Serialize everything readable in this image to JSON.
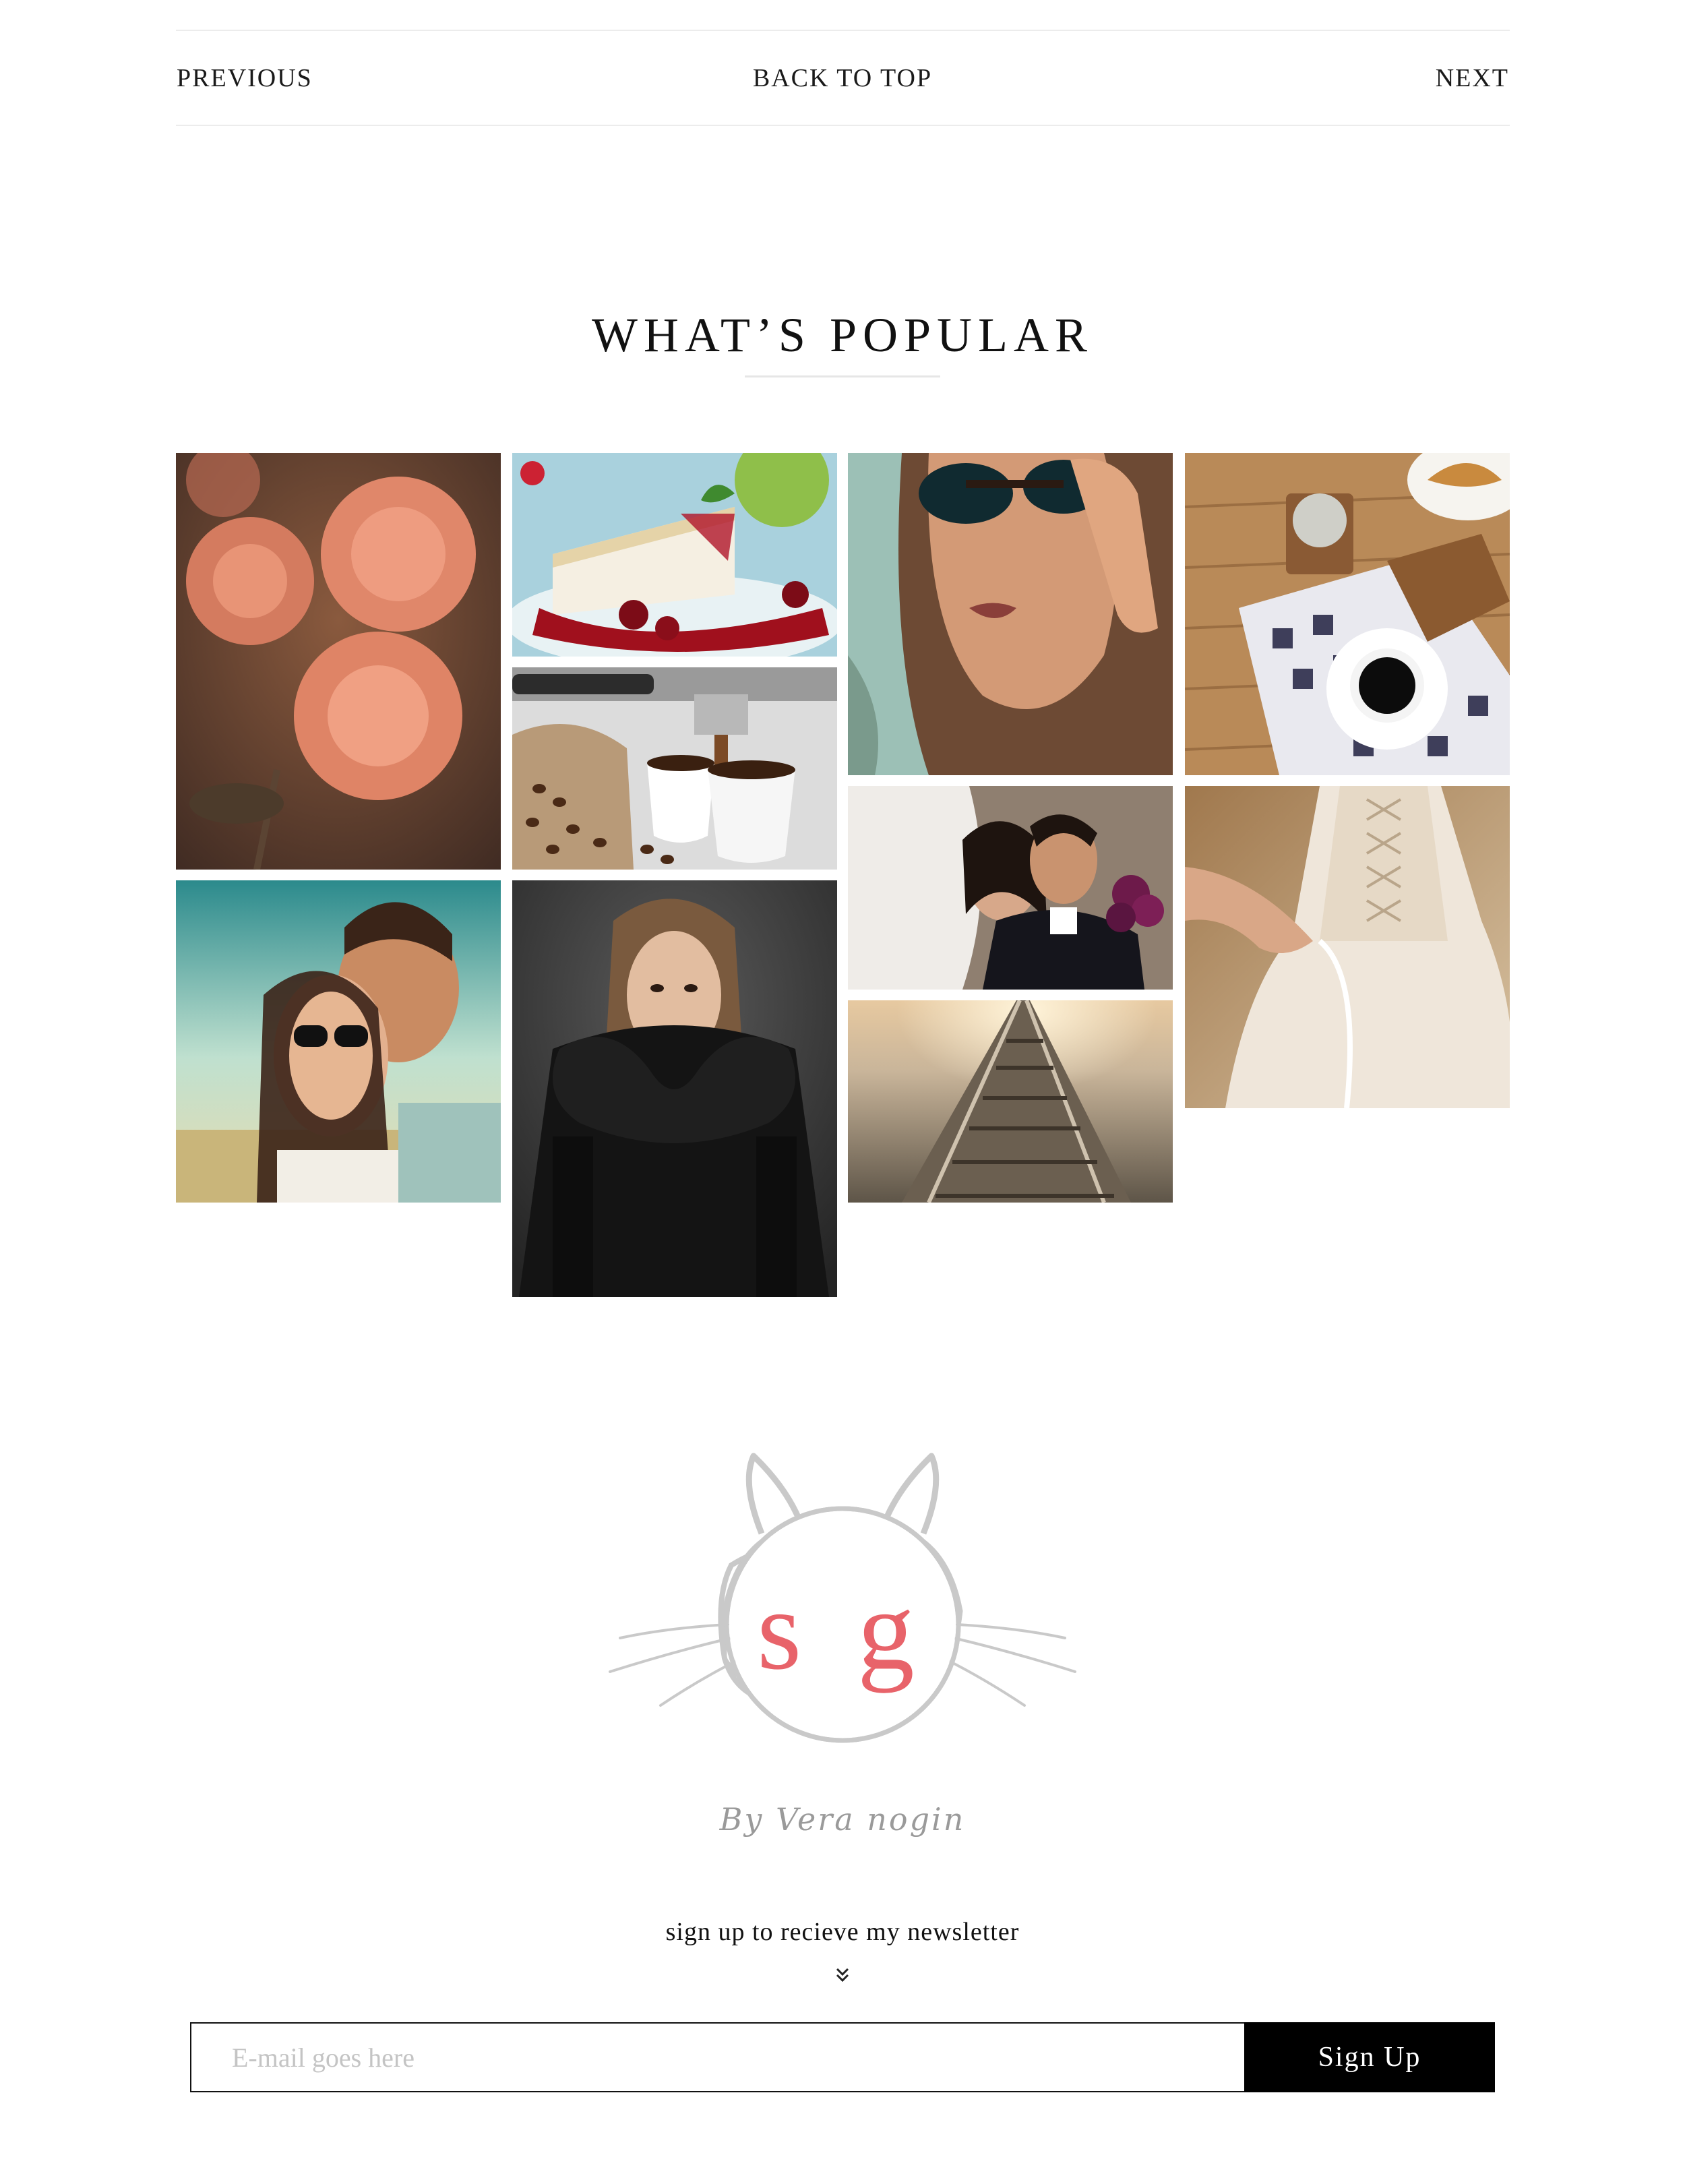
{
  "post_nav": {
    "previous_label": "PREVIOUS",
    "back_to_top_label": "BACK TO TOP",
    "next_label": "NEXT"
  },
  "popular": {
    "title": "WHAT’S POPULAR",
    "tiles": [
      {
        "name": "popular-roses"
      },
      {
        "name": "popular-cheesecake"
      },
      {
        "name": "popular-espresso"
      },
      {
        "name": "popular-sunglasses-woman"
      },
      {
        "name": "popular-coffee-table"
      },
      {
        "name": "popular-couple-sunglasses"
      },
      {
        "name": "popular-fur-coat"
      },
      {
        "name": "popular-wedding-couple"
      },
      {
        "name": "popular-railroad"
      },
      {
        "name": "popular-wedding-dress"
      }
    ]
  },
  "logo": {
    "monogram": "s g",
    "signature": "By Vera nogin",
    "accent_color": "#e8636a",
    "line_color": "#c9c9c9"
  },
  "newsletter": {
    "heading": "sign up to recieve my newsletter",
    "chevron_icon": "double-chevron-down-icon",
    "email_placeholder": "E-mail goes here",
    "email_value": "",
    "signup_label": "Sign Up"
  }
}
